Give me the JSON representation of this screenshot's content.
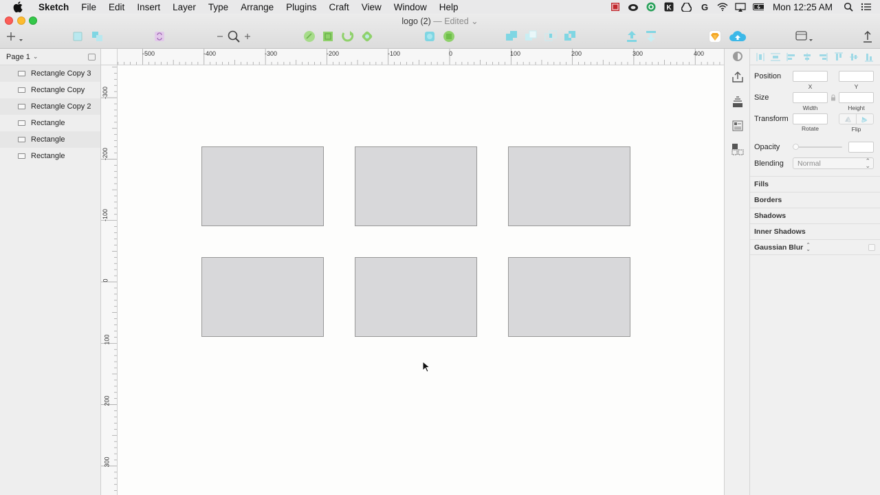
{
  "menubar": {
    "app": "Sketch",
    "menus": [
      "File",
      "Edit",
      "Insert",
      "Layer",
      "Type",
      "Arrange",
      "Plugins",
      "Craft",
      "View",
      "Window",
      "Help"
    ],
    "clock": "Mon 12:25 AM"
  },
  "window": {
    "doc_title": "logo (2)",
    "edited_label": "— Edited"
  },
  "layers_panel": {
    "page_name": "Page 1",
    "layers": [
      {
        "label": "Rectangle Copy 3"
      },
      {
        "label": "Rectangle Copy"
      },
      {
        "label": "Rectangle Copy 2"
      },
      {
        "label": "Rectangle"
      },
      {
        "label": "Rectangle"
      },
      {
        "label": "Rectangle"
      }
    ]
  },
  "rulers": {
    "top": [
      "-500",
      "-400",
      "-300",
      "-200",
      "-100",
      "0",
      "100",
      "200",
      "300",
      "400"
    ],
    "left": [
      "-300",
      "-200",
      "-100",
      "0",
      "100",
      "200",
      "300"
    ]
  },
  "inspector": {
    "position_label": "Position",
    "x_label": "X",
    "y_label": "Y",
    "size_label": "Size",
    "width_label": "Width",
    "height_label": "Height",
    "transform_label": "Transform",
    "rotate_label": "Rotate",
    "flip_label": "Flip",
    "opacity_label": "Opacity",
    "blending_label": "Blending",
    "blending_value": "Normal",
    "sections": [
      "Fills",
      "Borders",
      "Shadows",
      "Inner Shadows",
      "Gaussian Blur"
    ]
  },
  "colors": {
    "accent_cyan": "#6fd3e0",
    "accent_green": "#8fd16b",
    "sketch_orange": "#f5a623",
    "shape_fill": "#d8d8da",
    "shape_border": "#979797"
  }
}
